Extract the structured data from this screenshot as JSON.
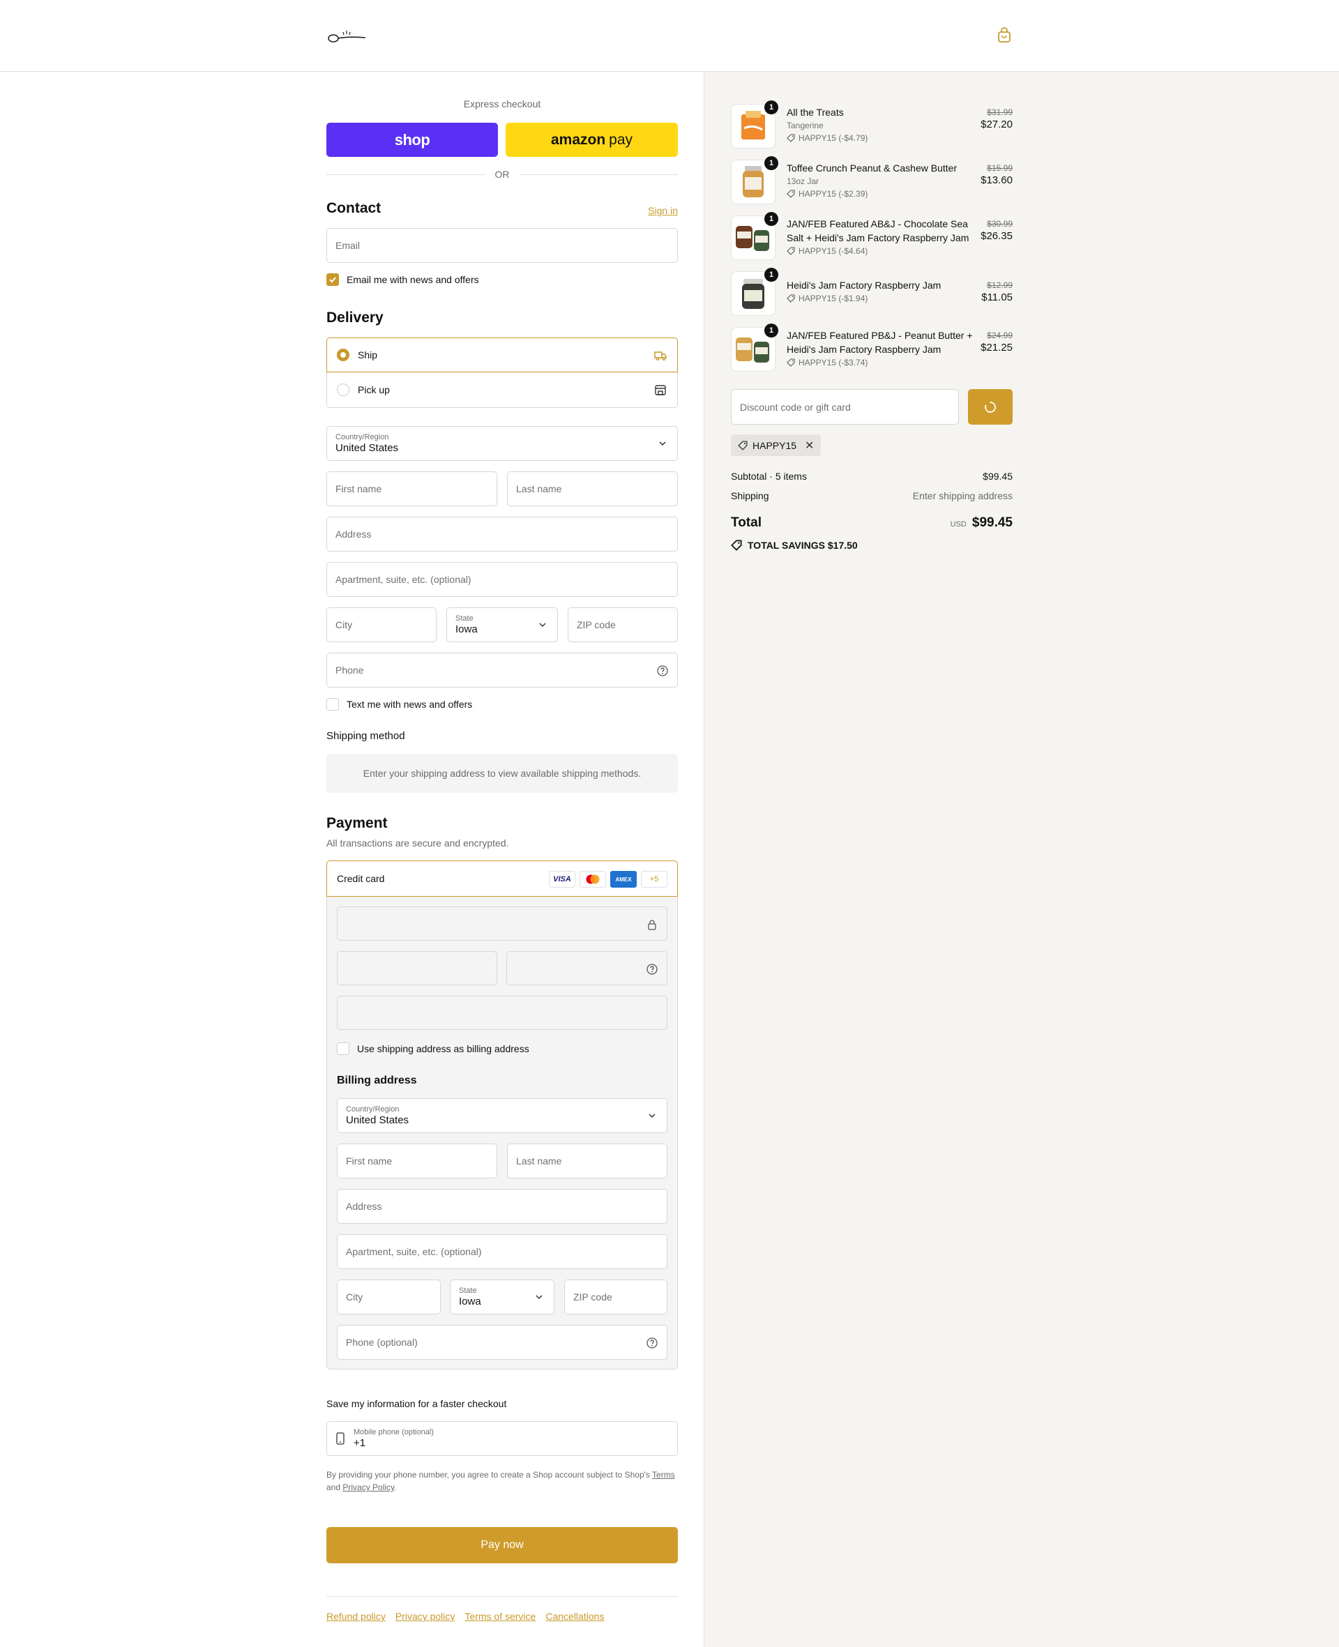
{
  "header": {
    "logo_icon": "spoon-logo-icon",
    "cart_icon": "shopping-bag-icon"
  },
  "express": {
    "title": "Express checkout",
    "shop_label": "shop",
    "amazon_label": "amazon",
    "amazon_pay": "pay",
    "or": "OR"
  },
  "contact": {
    "title": "Contact",
    "sign_in": "Sign in",
    "email_placeholder": "Email",
    "news_label": "Email me with news and offers"
  },
  "delivery": {
    "title": "Delivery",
    "ship": "Ship",
    "pickup": "Pick up",
    "country_label": "Country/Region",
    "country_value": "United States",
    "first_name": "First name",
    "last_name": "Last name",
    "address": "Address",
    "apartment": "Apartment, suite, etc. (optional)",
    "city": "City",
    "state_label": "State",
    "state_value": "Iowa",
    "zip": "ZIP code",
    "phone": "Phone",
    "text_me": "Text me with news and offers"
  },
  "shipping_method": {
    "title": "Shipping method",
    "placeholder": "Enter your shipping address to view available shipping methods."
  },
  "payment": {
    "title": "Payment",
    "subtitle": "All transactions are secure and encrypted.",
    "credit_card": "Credit card",
    "cards": [
      "VISA",
      "",
      "AMEX",
      "+5"
    ],
    "use_shipping": "Use shipping address as billing address",
    "billing_title": "Billing address",
    "country_label": "Country/Region",
    "country_value": "United States",
    "first_name": "First name",
    "last_name": "Last name",
    "address": "Address",
    "apartment": "Apartment, suite, etc. (optional)",
    "city": "City",
    "state_label": "State",
    "state_value": "Iowa",
    "zip": "ZIP code",
    "phone": "Phone (optional)"
  },
  "save_info": {
    "title": "Save my information for a faster checkout",
    "mobile_label": "Mobile phone (optional)",
    "mobile_value": "+1",
    "legal_pre": "By providing your phone number, you agree to create a Shop account subject to Shop's ",
    "terms": "Terms",
    "and": " and ",
    "privacy": "Privacy Policy",
    "period": "."
  },
  "pay_now": "Pay now",
  "footer": {
    "links": [
      "Refund policy",
      "Privacy policy",
      "Terms of service",
      "Cancellations"
    ]
  },
  "summary": {
    "items": [
      {
        "qty": "1",
        "name": "All the Treats",
        "variant": "Tangerine",
        "discount": "HAPPY15 (-$4.79)",
        "old_price": "$31.99",
        "price": "$27.20"
      },
      {
        "qty": "1",
        "name": "Toffee Crunch Peanut & Cashew Butter",
        "variant": "13oz Jar",
        "discount": "HAPPY15 (-$2.39)",
        "old_price": "$15.99",
        "price": "$13.60"
      },
      {
        "qty": "1",
        "name": "JAN/FEB Featured AB&J - Chocolate Sea Salt + Heidi's Jam Factory Raspberry Jam",
        "variant": "",
        "discount": "HAPPY15 (-$4.64)",
        "old_price": "$30.99",
        "price": "$26.35"
      },
      {
        "qty": "1",
        "name": "Heidi's Jam Factory Raspberry Jam",
        "variant": "",
        "discount": "HAPPY15 (-$1.94)",
        "old_price": "$12.99",
        "price": "$11.05"
      },
      {
        "qty": "1",
        "name": "JAN/FEB Featured PB&J - Peanut Butter + Heidi's Jam Factory Raspberry Jam",
        "variant": "",
        "discount": "HAPPY15 (-$3.74)",
        "old_price": "$24.99",
        "price": "$21.25"
      }
    ],
    "discount_placeholder": "Discount code or gift card",
    "applied_code": "HAPPY15",
    "subtotal_label": "Subtotal · 5 items",
    "subtotal_value": "$99.45",
    "shipping_label": "Shipping",
    "shipping_value": "Enter shipping address",
    "total_label": "Total",
    "currency": "USD",
    "total_value": "$99.45",
    "savings_label": "TOTAL SAVINGS",
    "savings_value": "$17.50"
  },
  "colors": {
    "accent": "#cf9c2c",
    "shop": "#5a31f4",
    "amazon": "#ffd814"
  }
}
